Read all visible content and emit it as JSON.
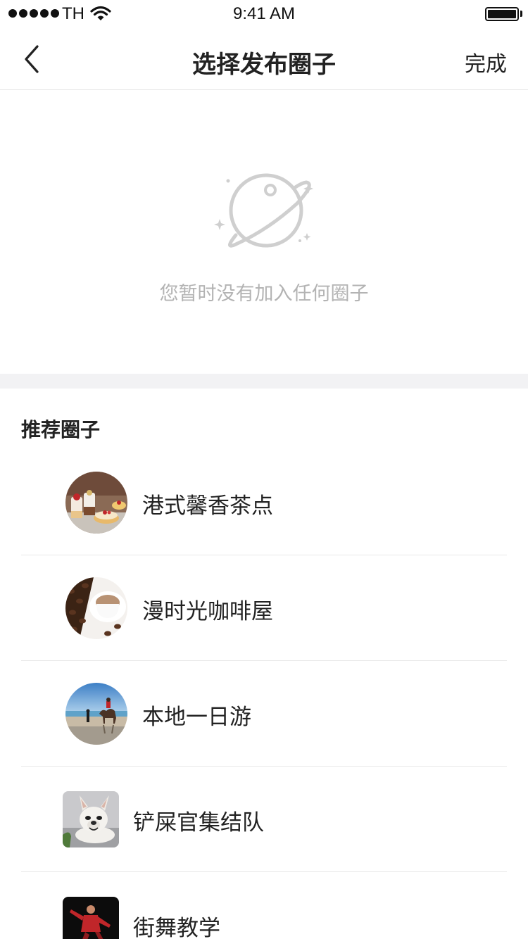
{
  "status_bar": {
    "carrier": "TH",
    "time": "9:41 AM"
  },
  "nav": {
    "title": "选择发布圈子",
    "done_label": "完成"
  },
  "empty_state": {
    "message": "您暂时没有加入任何圈子"
  },
  "recommended": {
    "title": "推荐圈子",
    "items": [
      {
        "label": "港式馨香茶点"
      },
      {
        "label": "漫时光咖啡屋"
      },
      {
        "label": "本地一日游"
      },
      {
        "label": "铲屎官集结队"
      },
      {
        "label": "街舞教学"
      }
    ]
  },
  "colors": {
    "text_primary": "#222222",
    "text_muted": "#b3b3b3",
    "divider": "#e8e8e8",
    "section_band": "#f2f2f4"
  }
}
